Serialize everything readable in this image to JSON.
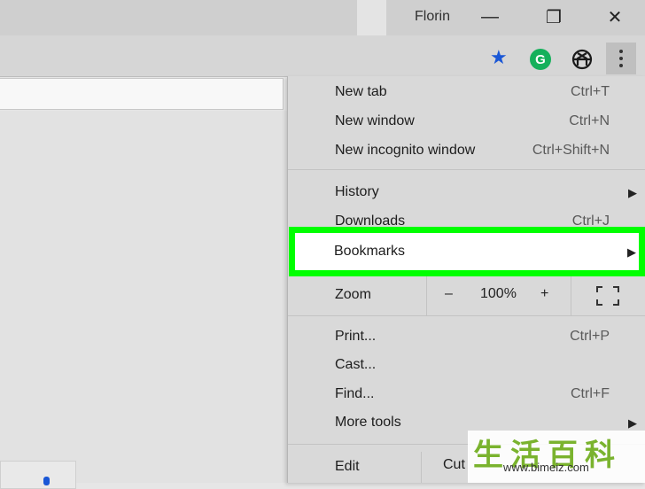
{
  "window": {
    "profile_name": "Florin",
    "minimize_icon": "minimize-icon",
    "restore_icon": "restore-icon",
    "close_icon": "close-icon",
    "minimize_glyph": "—",
    "restore_glyph": "❐",
    "close_glyph": "✕"
  },
  "toolbar": {
    "bookmark_icon": "star-icon",
    "grammarly_letter": "G",
    "extension_icon": "openai-knot-icon",
    "menu_icon": "vertical-dots-icon",
    "accent_blue": "#1a57d6",
    "grammarly_green": "#15b05b"
  },
  "menu": {
    "new_tab": {
      "label": "New tab",
      "shortcut": "Ctrl+T"
    },
    "new_window": {
      "label": "New window",
      "shortcut": "Ctrl+N"
    },
    "new_incognito": {
      "label": "New incognito window",
      "shortcut": "Ctrl+Shift+N"
    },
    "history": {
      "label": "History"
    },
    "downloads": {
      "label": "Downloads",
      "shortcut": "Ctrl+J"
    },
    "bookmarks": {
      "label": "Bookmarks",
      "highlight_color": "#00ff00"
    },
    "zoom": {
      "label": "Zoom",
      "minus": "–",
      "level": "100%",
      "plus": "+"
    },
    "print": {
      "label": "Print...",
      "shortcut": "Ctrl+P"
    },
    "cast": {
      "label": "Cast..."
    },
    "find": {
      "label": "Find...",
      "shortcut": "Ctrl+F"
    },
    "more_tools": {
      "label": "More tools"
    },
    "edit": {
      "label": "Edit",
      "cut": "Cut"
    },
    "submenu_arrow": "▶"
  },
  "watermark": {
    "chars": "生活百科",
    "url": "www.bimeiz.com"
  }
}
